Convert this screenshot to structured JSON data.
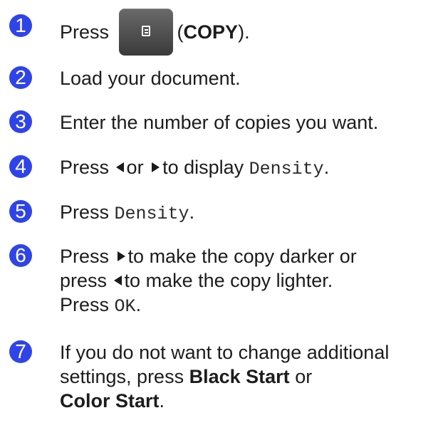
{
  "accent_color": "#2f44e8",
  "steps": [
    {
      "number": "1",
      "press": "Press",
      "paren_open": "(",
      "copy": "COPY",
      "paren_close": ").",
      "button_icon": "copy-document-icon"
    },
    {
      "number": "2",
      "text": "Load your document."
    },
    {
      "number": "3",
      "text": "Enter the number of copies you want."
    },
    {
      "number": "4",
      "press": "Press",
      "or": "or",
      "to_display": "to display",
      "density": "Density",
      "period": "."
    },
    {
      "number": "5",
      "press": "Press",
      "density": "Density",
      "period": "."
    },
    {
      "number": "6",
      "line1_press": "Press",
      "line1_rest": "to make the copy darker or",
      "line2_press": "press",
      "line2_rest": "to make the copy lighter.",
      "line3_press": "Press",
      "ok": "OK",
      "period": "."
    },
    {
      "number": "7",
      "line1": "If you do not want to change additional",
      "line2_text": "settings, press",
      "black_start": "Black Start",
      "or": "or",
      "color_start": "Color Start",
      "period": "."
    }
  ]
}
